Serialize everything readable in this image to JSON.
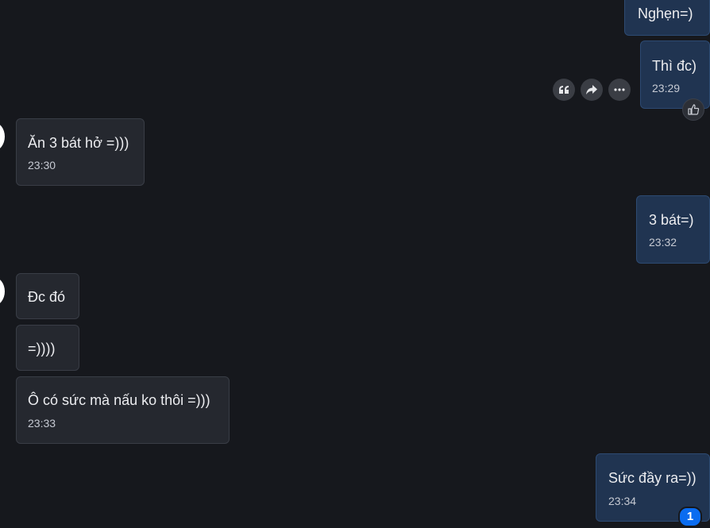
{
  "messages": [
    {
      "id": "m1",
      "direction": "out",
      "text": "Nghẹn=)",
      "time": ""
    },
    {
      "id": "m2",
      "direction": "out",
      "text": "Thì đc)",
      "time": "23:29"
    },
    {
      "id": "m3",
      "direction": "in",
      "text": "Ăn 3 bát hở =)))",
      "time": "23:30"
    },
    {
      "id": "m4",
      "direction": "out",
      "text": "3 bát=)",
      "time": "23:32"
    },
    {
      "id": "m5",
      "direction": "in",
      "text": "Đc đó",
      "time": ""
    },
    {
      "id": "m6",
      "direction": "in",
      "text": "=))))",
      "time": ""
    },
    {
      "id": "m7",
      "direction": "in",
      "text": "Ô có sức mà nấu ko thôi =)))",
      "time": "23:33"
    },
    {
      "id": "m8",
      "direction": "out",
      "text": "Sức đầy ra=))",
      "time": "23:34"
    }
  ],
  "message_actions": {
    "icons": [
      "quote-icon",
      "forward-icon",
      "more-icon"
    ]
  },
  "reaction": {
    "icon": "thumbs-up-icon"
  },
  "unread_badge": {
    "count": "1"
  },
  "colors": {
    "background": "#16181d",
    "incoming_bubble": "#25282f",
    "outgoing_bubble": "#203451",
    "badge": "#0a6cf0"
  }
}
